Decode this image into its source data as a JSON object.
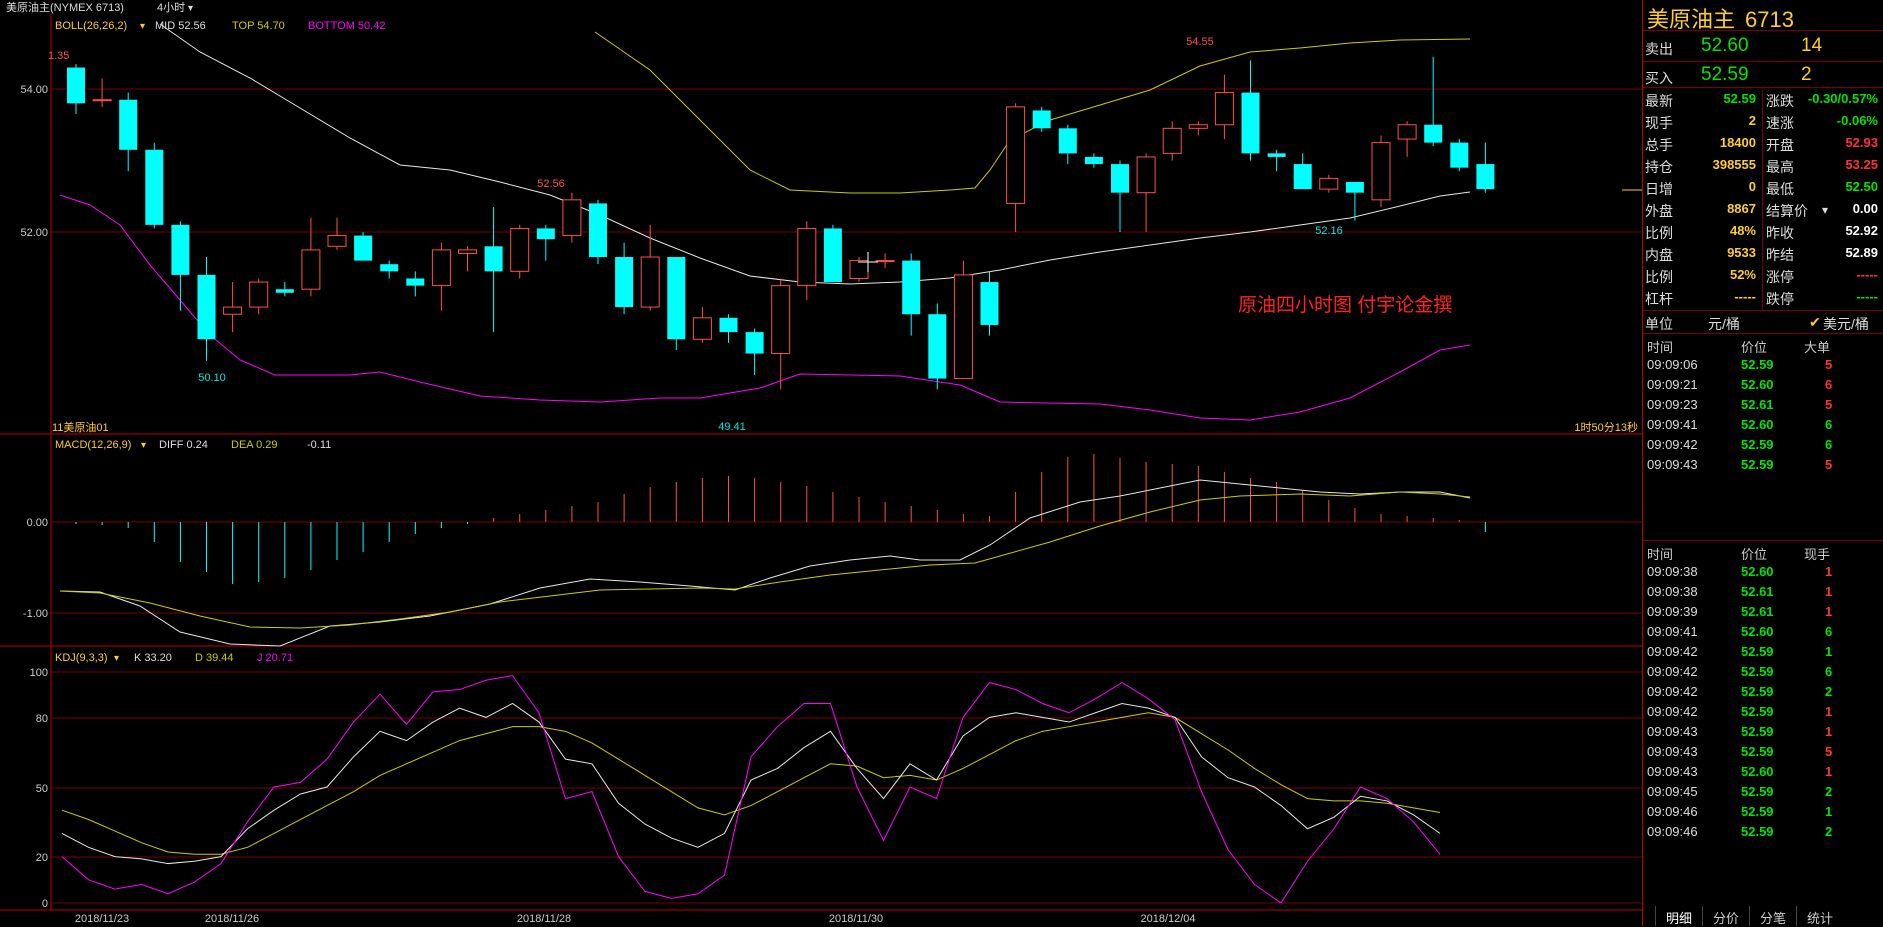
{
  "header": {
    "title": "美原油主(NYMEX 6713)",
    "period": "4小时",
    "boll_label": "BOLL(26,26,2)",
    "boll_mid": "MID 52.56",
    "boll_top": "TOP 54.70",
    "boll_bottom": "BOTTOM 50.42",
    "left_cut_label": "1.35"
  },
  "main_chart": {
    "y_labels": [
      "54.00",
      "52.00"
    ],
    "annotations": {
      "high": "54.55",
      "low1": "50.10",
      "low2": "49.41",
      "mid": "52.56",
      "right_low": "52.16"
    },
    "watermark": "原油四小时图  付宇论金撰",
    "bottom_left": "11美原油01",
    "bottom_right": "1时50分13秒"
  },
  "macd": {
    "label": "MACD(12,26,9)",
    "diff": "DIFF 0.24",
    "dea": "DEA 0.29",
    "macd_val": "-0.11",
    "y_labels": [
      "0.00",
      "-1.00"
    ]
  },
  "kdj": {
    "label": "KDJ(9,3,3)",
    "k": "K 33.20",
    "d": "D 39.44",
    "j": "J 20.71",
    "y_labels": [
      "100",
      "80",
      "50",
      "20",
      "0"
    ]
  },
  "x_axis": [
    "2018/11/23",
    "2018/11/26",
    "2018/11/28",
    "2018/11/30",
    "2018/12/04"
  ],
  "candles": [
    [
      54.3,
      53.8,
      54.35,
      53.65
    ],
    [
      53.85,
      53.85,
      54.15,
      53.75
    ],
    [
      53.85,
      53.15,
      53.95,
      52.85
    ],
    [
      53.15,
      52.1,
      53.25,
      52.05
    ],
    [
      52.1,
      51.4,
      52.15,
      50.9
    ],
    [
      51.4,
      50.5,
      51.65,
      50.2
    ],
    [
      50.85,
      50.95,
      51.3,
      50.6
    ],
    [
      50.95,
      51.3,
      51.35,
      50.85
    ],
    [
      51.2,
      51.15,
      51.3,
      51.1
    ],
    [
      51.2,
      51.75,
      52.2,
      51.1
    ],
    [
      51.8,
      51.95,
      52.2,
      51.75
    ],
    [
      51.95,
      51.6,
      52.0,
      51.6
    ],
    [
      51.55,
      51.45,
      51.6,
      51.35
    ],
    [
      51.35,
      51.25,
      51.45,
      51.1
    ],
    [
      51.25,
      51.75,
      51.85,
      50.9
    ],
    [
      51.7,
      51.75,
      51.8,
      51.45
    ],
    [
      51.8,
      51.45,
      52.35,
      50.6
    ],
    [
      51.45,
      52.05,
      52.1,
      51.35
    ],
    [
      52.05,
      51.9,
      52.1,
      51.6
    ],
    [
      51.95,
      52.45,
      52.55,
      51.85
    ],
    [
      52.4,
      51.65,
      52.45,
      51.55
    ],
    [
      51.65,
      50.95,
      51.85,
      50.85
    ],
    [
      50.95,
      51.65,
      52.1,
      50.9
    ],
    [
      51.65,
      50.5,
      51.65,
      50.35
    ],
    [
      50.5,
      50.8,
      50.95,
      50.45
    ],
    [
      50.8,
      50.6,
      50.85,
      50.45
    ],
    [
      50.6,
      50.3,
      50.65,
      50.0
    ],
    [
      50.3,
      51.25,
      51.35,
      49.8
    ],
    [
      51.25,
      52.05,
      52.15,
      51.05
    ],
    [
      52.05,
      51.3,
      52.1,
      51.3
    ],
    [
      51.35,
      51.6,
      51.65,
      51.3
    ],
    [
      51.6,
      51.6,
      51.7,
      51.5
    ],
    [
      51.6,
      50.85,
      51.7,
      50.55
    ],
    [
      50.85,
      49.95,
      51.0,
      49.8
    ],
    [
      49.95,
      51.4,
      51.6,
      49.95
    ],
    [
      51.3,
      50.7,
      51.45,
      50.55
    ],
    [
      52.4,
      53.75,
      53.8,
      52.0
    ],
    [
      53.7,
      53.45,
      53.75,
      53.4
    ],
    [
      53.45,
      53.1,
      53.5,
      52.95
    ],
    [
      53.05,
      52.95,
      53.1,
      52.9
    ],
    [
      52.95,
      52.55,
      53.0,
      52.0
    ],
    [
      52.55,
      53.05,
      53.1,
      52.0
    ],
    [
      53.1,
      53.45,
      53.55,
      53.0
    ],
    [
      53.45,
      53.5,
      53.55,
      53.35
    ],
    [
      53.5,
      53.95,
      54.2,
      53.3
    ],
    [
      53.95,
      53.1,
      54.4,
      53.0
    ],
    [
      53.1,
      53.05,
      53.15,
      52.85
    ],
    [
      52.95,
      52.6,
      53.1,
      52.6
    ],
    [
      52.6,
      52.75,
      52.8,
      52.55
    ],
    [
      52.7,
      52.55,
      52.7,
      52.16
    ],
    [
      52.45,
      53.25,
      53.35,
      52.35
    ],
    [
      53.3,
      53.5,
      53.55,
      53.05
    ],
    [
      53.5,
      53.25,
      54.45,
      53.2
    ],
    [
      53.25,
      52.9,
      53.3,
      52.85
    ],
    [
      52.95,
      52.6,
      53.25,
      52.55
    ]
  ],
  "colors": {
    "up": "#ff4d4d",
    "down": "#00ffff",
    "boll_mid": "#e6e6e6",
    "boll_top": "#cccc00",
    "boll_bottom": "#ff00ff",
    "grid": "#7a0000",
    "yellow": "#ffcc33",
    "green": "#00e500",
    "red": "#ff3333"
  },
  "quote": {
    "name": "美原油主",
    "code": "6713",
    "sell": {
      "label": "卖出",
      "price": "52.60",
      "qty": "14"
    },
    "buy": {
      "label": "买入",
      "price": "52.59",
      "qty": "2"
    },
    "rows": [
      {
        "l1": "最新",
        "v1": "52.59",
        "c1": "green",
        "l2": "涨跌",
        "v2": "-0.30/0.57%",
        "c2": "green"
      },
      {
        "l1": "现手",
        "v1": "2",
        "c1": "yellow",
        "l2": "速涨",
        "v2": "-0.06%",
        "c2": "green"
      },
      {
        "l1": "总手",
        "v1": "18400",
        "c1": "yellow",
        "l2": "开盘",
        "v2": "52.93",
        "c2": "red"
      },
      {
        "l1": "持仓",
        "v1": "398555",
        "c1": "yellow",
        "l2": "最高",
        "v2": "53.25",
        "c2": "red"
      },
      {
        "l1": "日增",
        "v1": "0",
        "c1": "yellow",
        "l2": "最低",
        "v2": "52.50",
        "c2": "green"
      },
      {
        "l1": "外盘",
        "v1": "8867",
        "c1": "yellow",
        "l2": "结算价",
        "v2": "0.00",
        "c2": "white"
      },
      {
        "l1": "比例",
        "v1": "48%",
        "c1": "yellow",
        "l2": "昨收",
        "v2": "52.92",
        "c2": "white"
      },
      {
        "l1": "内盘",
        "v1": "9533",
        "c1": "yellow",
        "l2": "昨结",
        "v2": "52.89",
        "c2": "white"
      },
      {
        "l1": "比例",
        "v1": "52%",
        "c1": "yellow",
        "l2": "涨停",
        "v2": "-----",
        "c2": "red"
      },
      {
        "l1": "杠杆",
        "v1": "-----",
        "c1": "yellow",
        "l2": "跌停",
        "v2": "-----",
        "c2": "green"
      }
    ],
    "unit_label": "单位",
    "unit_value": "元/桶",
    "unit_alt": "美元/桶"
  },
  "ticks_big": {
    "headers": [
      "时间",
      "价位",
      "大单"
    ],
    "rows": [
      {
        "t": "09:09:06",
        "p": "52.59",
        "pc": "green",
        "q": "5",
        "qc": "red"
      },
      {
        "t": "09:09:21",
        "p": "52.60",
        "pc": "green",
        "q": "6",
        "qc": "red"
      },
      {
        "t": "09:09:23",
        "p": "52.61",
        "pc": "green",
        "q": "5",
        "qc": "red"
      },
      {
        "t": "09:09:41",
        "p": "52.60",
        "pc": "green",
        "q": "6",
        "qc": "green"
      },
      {
        "t": "09:09:42",
        "p": "52.59",
        "pc": "green",
        "q": "6",
        "qc": "green"
      },
      {
        "t": "09:09:43",
        "p": "52.59",
        "pc": "green",
        "q": "5",
        "qc": "red"
      }
    ]
  },
  "ticks": {
    "headers": [
      "时间",
      "价位",
      "现手"
    ],
    "rows": [
      {
        "t": "09:09:38",
        "p": "52.60",
        "pc": "green",
        "q": "1",
        "qc": "red"
      },
      {
        "t": "09:09:38",
        "p": "52.61",
        "pc": "green",
        "q": "1",
        "qc": "red"
      },
      {
        "t": "09:09:39",
        "p": "52.61",
        "pc": "green",
        "q": "1",
        "qc": "red"
      },
      {
        "t": "09:09:41",
        "p": "52.60",
        "pc": "green",
        "q": "6",
        "qc": "green"
      },
      {
        "t": "09:09:42",
        "p": "52.59",
        "pc": "green",
        "q": "1",
        "qc": "green"
      },
      {
        "t": "09:09:42",
        "p": "52.59",
        "pc": "green",
        "q": "6",
        "qc": "green"
      },
      {
        "t": "09:09:42",
        "p": "52.59",
        "pc": "green",
        "q": "2",
        "qc": "green"
      },
      {
        "t": "09:09:42",
        "p": "52.59",
        "pc": "green",
        "q": "1",
        "qc": "red"
      },
      {
        "t": "09:09:43",
        "p": "52.59",
        "pc": "green",
        "q": "1",
        "qc": "red"
      },
      {
        "t": "09:09:43",
        "p": "52.59",
        "pc": "green",
        "q": "5",
        "qc": "red"
      },
      {
        "t": "09:09:43",
        "p": "52.60",
        "pc": "green",
        "q": "1",
        "qc": "red"
      },
      {
        "t": "09:09:45",
        "p": "52.59",
        "pc": "green",
        "q": "2",
        "qc": "green"
      },
      {
        "t": "09:09:46",
        "p": "52.59",
        "pc": "green",
        "q": "1",
        "qc": "green"
      },
      {
        "t": "09:09:46",
        "p": "52.59",
        "pc": "green",
        "q": "2",
        "qc": "green"
      }
    ]
  },
  "tabs": [
    "明细",
    "分价",
    "分笔",
    "统计"
  ]
}
